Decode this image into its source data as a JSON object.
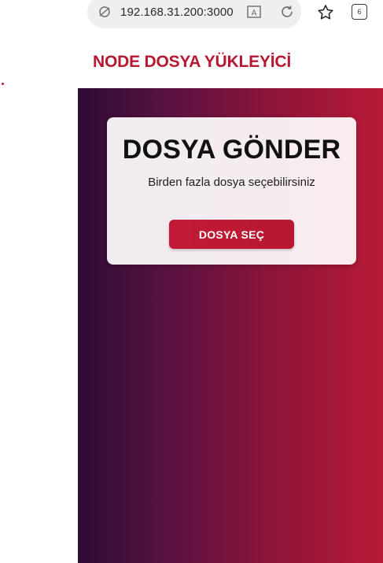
{
  "browser": {
    "url": "192.168.31.200:3000",
    "tab_count": "6"
  },
  "app": {
    "title": "NODE DOSYA YÜKLEYİCİ"
  },
  "upload_card": {
    "title": "DOSYA GÖNDER",
    "subtitle": "Birden fazla dosya seçebilirsiniz",
    "button_label": "DOSYA SEÇ"
  },
  "colors": {
    "brand_red": "#b5182f",
    "gradient_start": "#2e0c36",
    "gradient_end": "#b81a35"
  },
  "icons": [
    "site-info-icon",
    "reader-mode-icon",
    "reload-icon",
    "bookmark-star-icon",
    "tabs-icon"
  ]
}
